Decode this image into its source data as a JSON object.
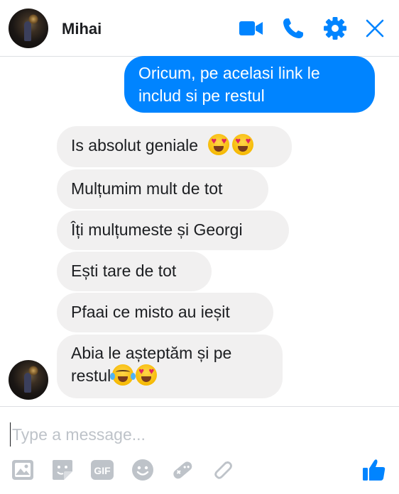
{
  "header": {
    "contact_name": "Mihai",
    "icons": [
      "video-camera-icon",
      "phone-icon",
      "gear-icon",
      "close-icon"
    ],
    "accent_color": "#0084ff"
  },
  "messages": [
    {
      "direction": "outgoing",
      "lines": [
        "Oricum, pe acelasi link le",
        "includ si pe restul"
      ]
    },
    {
      "direction": "incoming",
      "text": "Is absolut geniale",
      "emojis": [
        "heart-eyes-emoji",
        "heart-eyes-emoji"
      ]
    },
    {
      "direction": "incoming",
      "text": "Mulțumim mult de tot"
    },
    {
      "direction": "incoming",
      "text": "Îți mulțumeste și Georgi"
    },
    {
      "direction": "incoming",
      "text": "Ești tare de tot"
    },
    {
      "direction": "incoming",
      "text": "Pfaai ce misto au ieșit"
    },
    {
      "direction": "incoming",
      "lines": [
        "Abia le așteptăm și pe",
        "restul"
      ],
      "emojis": [
        "tears-of-joy-emoji",
        "heart-eyes-emoji"
      ]
    }
  ],
  "composer": {
    "placeholder": "Type a message...",
    "tools": [
      "image-icon",
      "sticker-icon",
      "gif-icon",
      "emoji-icon",
      "game-controller-icon",
      "attachment-icon",
      "thumbs-up-icon"
    ],
    "gif_label": "GIF"
  }
}
